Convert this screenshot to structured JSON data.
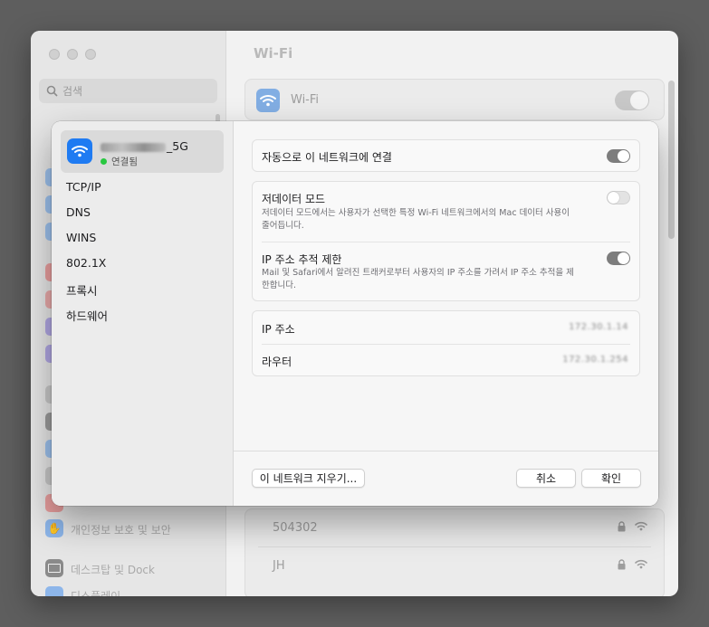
{
  "background": {
    "title": "Wi-Fi",
    "search_placeholder": "검색",
    "wifi_card_label": "Wi-Fi",
    "sidebar_items": [
      {
        "label": "개인정보 보호 및 보안",
        "icon": "hand-icon",
        "color": "#4a8de0"
      },
      {
        "label": "데스크탑 및 Dock",
        "icon": "desktop-icon",
        "color": "#4b4b4b"
      },
      {
        "label": "디스플레이",
        "icon": "display-icon",
        "color": "#3c83e6"
      }
    ],
    "networks": [
      {
        "name": "504302",
        "locked": true
      },
      {
        "name": "JH",
        "locked": true
      }
    ]
  },
  "dialog": {
    "network": {
      "name_suffix": "_5G",
      "status": "연결됨",
      "status_color": "#28c840"
    },
    "sidebar_items": [
      "TCP/IP",
      "DNS",
      "WINS",
      "802.1X",
      "프록시",
      "하드웨어"
    ],
    "auto_join": {
      "label": "자동으로 이 네트워크에 연결",
      "on": true
    },
    "low_data": {
      "label": "저데이터 모드",
      "description": "저데이터 모드에서는 사용자가 선택한 특정 Wi-Fi 네트워크에서의 Mac 데이터 사용이 줄어듭니다.",
      "on": false
    },
    "limit_ip": {
      "label": "IP 주소 추적 제한",
      "description": "Mail 및 Safari에서 알려진 트래커로부터 사용자의 IP 주소를 가려서 IP 주소 추적을 제한합니다.",
      "on": true
    },
    "ip_address": {
      "label": "IP 주소",
      "value": "172.30.1.14"
    },
    "router": {
      "label": "라우터",
      "value": "172.30.1.254"
    },
    "buttons": {
      "forget": "이 네트워크 지우기...",
      "cancel": "취소",
      "ok": "확인"
    }
  },
  "colors": {
    "accent": "#1f7bf2"
  }
}
